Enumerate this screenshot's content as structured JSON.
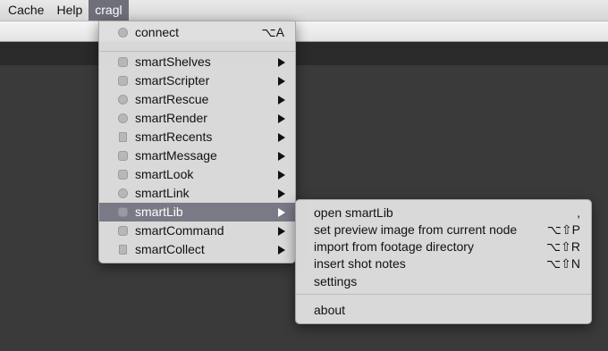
{
  "menubar": {
    "items": [
      "Cache",
      "Help",
      "cragl"
    ]
  },
  "main_menu": {
    "connect": {
      "label": "connect",
      "shortcut": "⌥A"
    },
    "items": [
      {
        "label": "smartShelves"
      },
      {
        "label": "smartScripter"
      },
      {
        "label": "smartRescue"
      },
      {
        "label": "smartRender"
      },
      {
        "label": "smartRecents"
      },
      {
        "label": "smartMessage"
      },
      {
        "label": "smartLook"
      },
      {
        "label": "smartLink"
      },
      {
        "label": "smartLib"
      },
      {
        "label": "smartCommand"
      },
      {
        "label": "smartCollect"
      }
    ]
  },
  "submenu": {
    "items": [
      {
        "label": "open smartLib",
        "shortcut": ","
      },
      {
        "label": "set preview image from current node",
        "shortcut": "⌥⇧P"
      },
      {
        "label": "import from footage directory",
        "shortcut": "⌥⇧R"
      },
      {
        "label": "insert shot notes",
        "shortcut": "⌥⇧N"
      },
      {
        "label": "settings",
        "shortcut": ""
      }
    ],
    "about": {
      "label": "about"
    }
  },
  "colors": {
    "highlight": "#7a7a86",
    "menu_bg": "#dedede",
    "workspace": "#3a3a3a"
  }
}
